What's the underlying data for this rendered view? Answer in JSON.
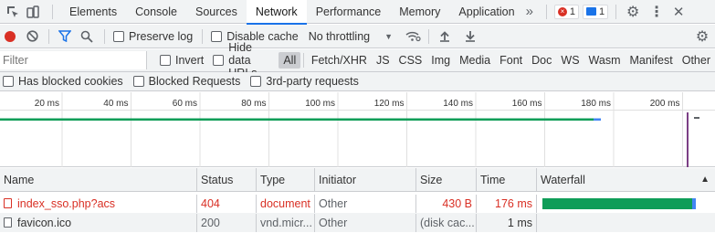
{
  "tabs": [
    {
      "label": "Elements"
    },
    {
      "label": "Console"
    },
    {
      "label": "Sources"
    },
    {
      "label": "Network"
    },
    {
      "label": "Performance"
    },
    {
      "label": "Memory"
    },
    {
      "label": "Application"
    }
  ],
  "more_tabs": "»",
  "errors_count": "1",
  "messages_count": "1",
  "toolbar": {
    "preserve_log": "Preserve log",
    "disable_cache": "Disable cache",
    "throttling": "No throttling"
  },
  "filter": {
    "placeholder": "Filter",
    "invert": "Invert",
    "hide_data_urls": "Hide data URLs",
    "types": [
      "All",
      "Fetch/XHR",
      "JS",
      "CSS",
      "Img",
      "Media",
      "Font",
      "Doc",
      "WS",
      "Wasm",
      "Manifest",
      "Other"
    ],
    "selected": "All"
  },
  "cookies": {
    "has_blocked": "Has blocked cookies",
    "blocked_requests": "Blocked Requests",
    "third_party": "3rd-party requests"
  },
  "overview_ticks": [
    "20 ms",
    "40 ms",
    "60 ms",
    "80 ms",
    "100 ms",
    "120 ms",
    "140 ms",
    "160 ms",
    "180 ms",
    "200 ms"
  ],
  "columns": {
    "name": "Name",
    "status": "Status",
    "type": "Type",
    "initiator": "Initiator",
    "size": "Size",
    "time": "Time",
    "waterfall": "Waterfall"
  },
  "requests": [
    {
      "name": "index_sso.php?acs",
      "status": "404",
      "type": "document",
      "initiator": "Other",
      "size": "430 B",
      "time": "176 ms",
      "error": true
    },
    {
      "name": "favicon.ico",
      "status": "200",
      "type": "vnd.micr...",
      "initiator": "Other",
      "size": "(disk cac...",
      "time": "1 ms",
      "error": false
    }
  ],
  "colors": {
    "accent": "#1a73e8",
    "error": "#d93025",
    "waterfall_green": "#0f9d58",
    "load_line": "#7b3f85"
  }
}
